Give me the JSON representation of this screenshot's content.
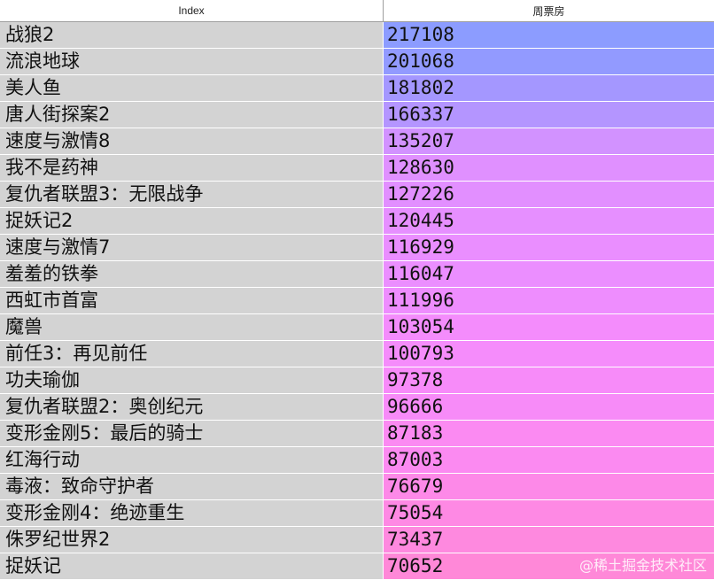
{
  "table": {
    "headers": {
      "index": "Index",
      "value": "周票房"
    },
    "rows": [
      {
        "name": "战狼2",
        "value": "217108",
        "color": "#8c9cff"
      },
      {
        "name": "流浪地球",
        "value": "201068",
        "color": "#929aff"
      },
      {
        "name": "美人鱼",
        "value": "181802",
        "color": "#a497ff"
      },
      {
        "name": "唐人街探案2",
        "value": "166337",
        "color": "#b495ff"
      },
      {
        "name": "速度与激情8",
        "value": "135207",
        "color": "#d292ff"
      },
      {
        "name": "我不是药神",
        "value": "128630",
        "color": "#e090ff"
      },
      {
        "name": "复仇者联盟3：无限战争",
        "value": "127226",
        "color": "#e28fff"
      },
      {
        "name": "捉妖记2",
        "value": "120445",
        "color": "#e68fff"
      },
      {
        "name": "速度与激情7",
        "value": "116929",
        "color": "#ea8eff"
      },
      {
        "name": "羞羞的铁拳",
        "value": "116047",
        "color": "#eb8eff"
      },
      {
        "name": "西虹市首富",
        "value": "111996",
        "color": "#ee8dfe"
      },
      {
        "name": "魔兽",
        "value": "103054",
        "color": "#f48cfc"
      },
      {
        "name": "前任3：再见前任",
        "value": "100793",
        "color": "#f58cfb"
      },
      {
        "name": "功夫瑜伽",
        "value": "97378",
        "color": "#f78bf9"
      },
      {
        "name": "复仇者联盟2：奥创纪元",
        "value": "96666",
        "color": "#f78bf8"
      },
      {
        "name": "变形金刚5：最后的骑士",
        "value": "87183",
        "color": "#fb8af2"
      },
      {
        "name": "红海行动",
        "value": "87003",
        "color": "#fb8af1"
      },
      {
        "name": "毒液：致命守护者",
        "value": "76679",
        "color": "#fd89e8"
      },
      {
        "name": "变形金刚4：绝迹重生",
        "value": "75054",
        "color": "#fe89e4"
      },
      {
        "name": "侏罗纪世界2",
        "value": "73437",
        "color": "#fe89df"
      },
      {
        "name": "捉妖记",
        "value": "70652",
        "color": "#ff88d8"
      }
    ]
  },
  "watermark": "@稀土掘金技术社区"
}
